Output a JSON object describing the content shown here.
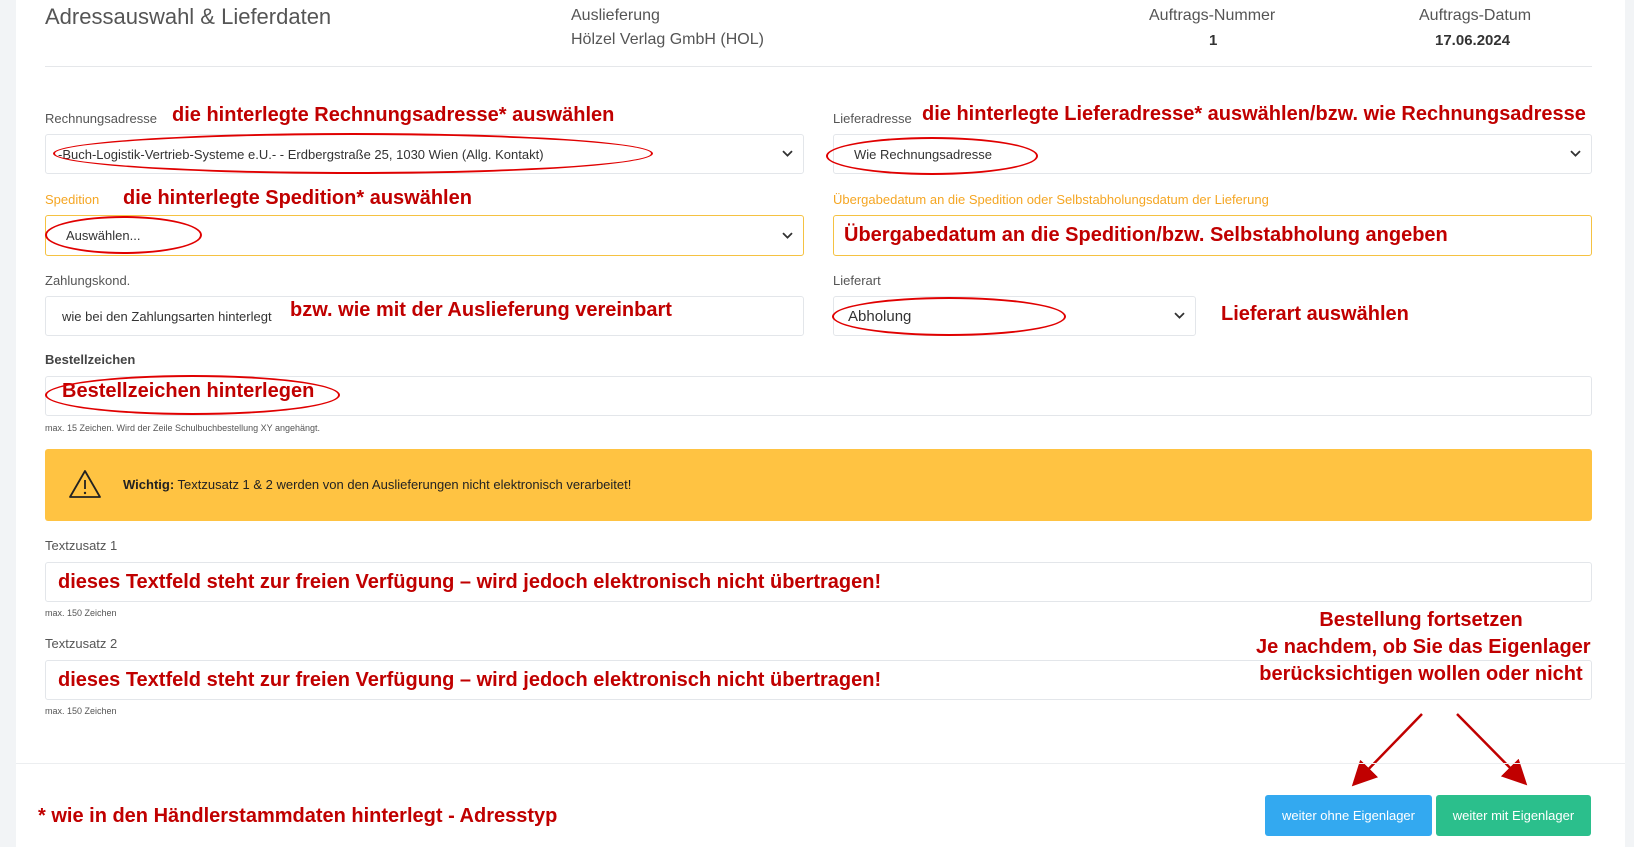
{
  "header": {
    "title": "Adressauswahl & Lieferdaten",
    "auslieferung_label": "Auslieferung",
    "auslieferung_value": "Hölzel Verlag GmbH (HOL)",
    "auftragsnummer_label": "Auftrags-Nummer",
    "auftragsnummer_value": "1",
    "auftragsdatum_label": "Auftrags-Datum",
    "auftragsdatum_value": "17.06.2024"
  },
  "form": {
    "rechnungsadresse_label": "Rechnungsadresse",
    "rechnungsadresse_value": "-Buch-Logistik-Vertrieb-Systeme e.U.- - Erdbergstraße 25, 1030 Wien (Allg. Kontakt)",
    "lieferadresse_label": "Lieferadresse",
    "lieferadresse_value": "Wie Rechnungsadresse",
    "spedition_label": "Spedition",
    "spedition_value": "Auswählen...",
    "uebergabedatum_label": "Übergabedatum an die Spedition oder Selbstabholungsdatum der Lieferung",
    "zahlungskond_label": "Zahlungskond.",
    "zahlungskond_value": "wie bei den Zahlungsarten hinterlegt",
    "lieferart_label": "Lieferart",
    "lieferart_value": "Abholung",
    "bestellzeichen_label": "Bestellzeichen",
    "bestellzeichen_help": "max. 15 Zeichen. Wird der Zeile Schulbuchbestellung XY angehängt.",
    "alert_bold": "Wichtig:",
    "alert_text": " Textzusatz 1 & 2 werden von den Auslieferungen nicht elektronisch verarbeitet!",
    "textzusatz1_label": "Textzusatz 1",
    "textzusatz1_help": "max. 150 Zeichen",
    "textzusatz2_label": "Textzusatz 2",
    "textzusatz2_help": "max. 150 Zeichen"
  },
  "buttons": {
    "ohne_label": "weiter ohne Eigenlager",
    "mit_label": "weiter mit Eigenlager"
  },
  "annotations": {
    "rechnungsadresse": "die hinterlegte Rechnungsadresse* auswählen",
    "lieferadresse": "die hinterlegte Lieferadresse* auswählen/bzw. wie Rechnungsadresse",
    "spedition": "die hinterlegte Spedition* auswählen",
    "uebergabedatum": "Übergabedatum an die Spedition/bzw. Selbstabholung angeben",
    "zahlungskond": "bzw. wie mit der Auslieferung vereinbart",
    "lieferart": "Lieferart auswählen",
    "bestellzeichen": "Bestellzeichen hinterlegen",
    "textzusatz1": "dieses Textfeld steht zur freien Verfügung – wird jedoch elektronisch nicht übertragen!",
    "textzusatz2": "dieses Textfeld steht zur freien Verfügung – wird jedoch elektronisch nicht übertragen!",
    "fortsetzen_line1": "Bestellung fortsetzen",
    "fortsetzen_line2": "Je nachdem, ob Sie das Eigenlager",
    "fortsetzen_line3": "berücksichtigen wollen oder nicht",
    "footnote": "* wie in den Händlerstammdaten hinterlegt - Adresstyp"
  },
  "colors": {
    "annotation_red": "#c00000",
    "alert_yellow": "#ffc342",
    "button_blue": "#33a9f0",
    "button_green": "#2bbf8c",
    "label_orange": "#f5a623"
  },
  "icons": {
    "alert": "warning-triangle-icon",
    "select": "chevron-down-icon"
  }
}
